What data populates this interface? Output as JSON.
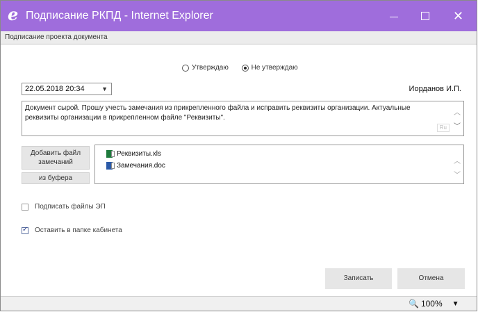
{
  "window": {
    "title": "Подписание РКПД - Internet Explorer",
    "accent_color": "#9f6ddc",
    "icon": "ie-icon",
    "controls": {
      "minimize": "minimize-icon",
      "maximize": "maximize-icon",
      "close": "✕"
    }
  },
  "subheader": {
    "title": "Подписание проекта документа"
  },
  "approval": {
    "options": [
      {
        "label": "Утверждаю",
        "checked": false
      },
      {
        "label": "Не утверждаю",
        "checked": true
      }
    ]
  },
  "date_select": {
    "value": "22.05.2018 20:34"
  },
  "author": "Иорданов И.П.",
  "comment": {
    "text": "Документ сырой. Прошу учесть замечания из прикрепленного файла и исправить реквизиты организации. Актуальные реквизиты организации в прикрепленном файле \"Реквизиты\".",
    "lang_badge": "Ru"
  },
  "attachments": {
    "add_button": "Добавить файл замечаний",
    "buffer_button": "из буфера",
    "files": [
      {
        "name": "Реквизиты.xls",
        "icon": "excel-file-icon"
      },
      {
        "name": "Замечания.doc",
        "icon": "word-file-icon"
      }
    ]
  },
  "options": {
    "sign_files": {
      "label": "Подписать файлы ЭП",
      "checked": false
    },
    "keep_in_folder": {
      "label": "Оставить в папке кабинета",
      "checked": true
    }
  },
  "buttons": {
    "save": "Записать",
    "cancel": "Отмена"
  },
  "status": {
    "zoom": "100%"
  }
}
